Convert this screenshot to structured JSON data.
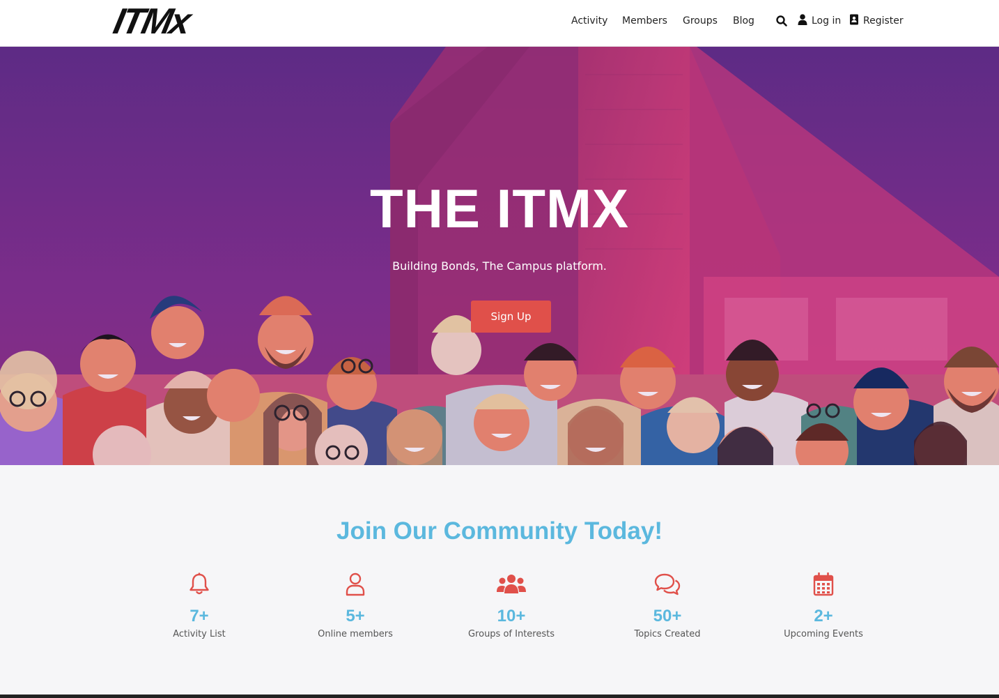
{
  "brand": {
    "logo_text": "ITMx"
  },
  "nav": {
    "items": [
      {
        "label": "Activity"
      },
      {
        "label": "Members"
      },
      {
        "label": "Groups"
      },
      {
        "label": "Blog"
      }
    ],
    "login_label": "Log in",
    "register_label": "Register"
  },
  "hero": {
    "title": "THE ITMX",
    "subtitle": "Building Bonds, The Campus platform.",
    "cta_label": "Sign Up"
  },
  "community": {
    "title": "Join Our Community Today!",
    "stats": [
      {
        "value": "7+",
        "label": "Activity List",
        "icon": "bell-icon"
      },
      {
        "value": "5+",
        "label": "Online members",
        "icon": "user-icon"
      },
      {
        "value": "10+",
        "label": "Groups of Interests",
        "icon": "users-group-icon"
      },
      {
        "value": "50+",
        "label": "Topics Created",
        "icon": "chat-bubbles-icon"
      },
      {
        "value": "2+",
        "label": "Upcoming Events",
        "icon": "calendar-icon"
      }
    ]
  },
  "colors": {
    "accent_red": "#e0504a",
    "accent_blue": "#5bb8de",
    "hero_purple": "#6a2f8a",
    "hero_pink": "#e83a7c"
  }
}
